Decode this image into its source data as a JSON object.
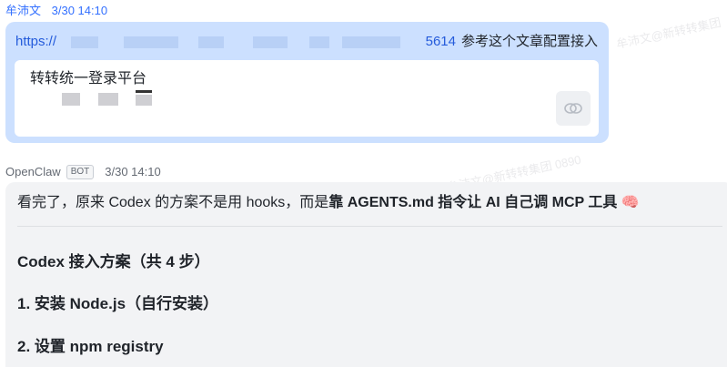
{
  "user_message": {
    "sender": "牟沛文",
    "time": "3/30 14:10",
    "link_prefix": "https://",
    "link_number": "5614",
    "link_suffix_text": "参考这个文章配置接入",
    "card_title": "转转统一登录平台",
    "card_icon": "link-icon"
  },
  "bot_message": {
    "sender": "OpenClaw",
    "badge": "BOT",
    "time": "3/30 14:10",
    "line1_normal": "看完了，原来 Codex 的方案不是用 hooks，而是",
    "line1_bold": "靠 AGENTS.md 指令让 AI 自己调 MCP 工具",
    "line1_emoji": "🧠",
    "heading": "Codex 接入方案（共 4 步）",
    "steps": [
      "1.  安装 Node.js（自行安装）",
      "2.  设置 npm registry"
    ]
  },
  "watermarks": [
    "牟沛文@新转转集团",
    "牟沛文@新转转集团 0890"
  ],
  "colors": {
    "user_bubble": "#cce0ff",
    "bot_bubble": "#f2f3f5",
    "link": "#245bdb",
    "sender_user": "#3370ff"
  }
}
